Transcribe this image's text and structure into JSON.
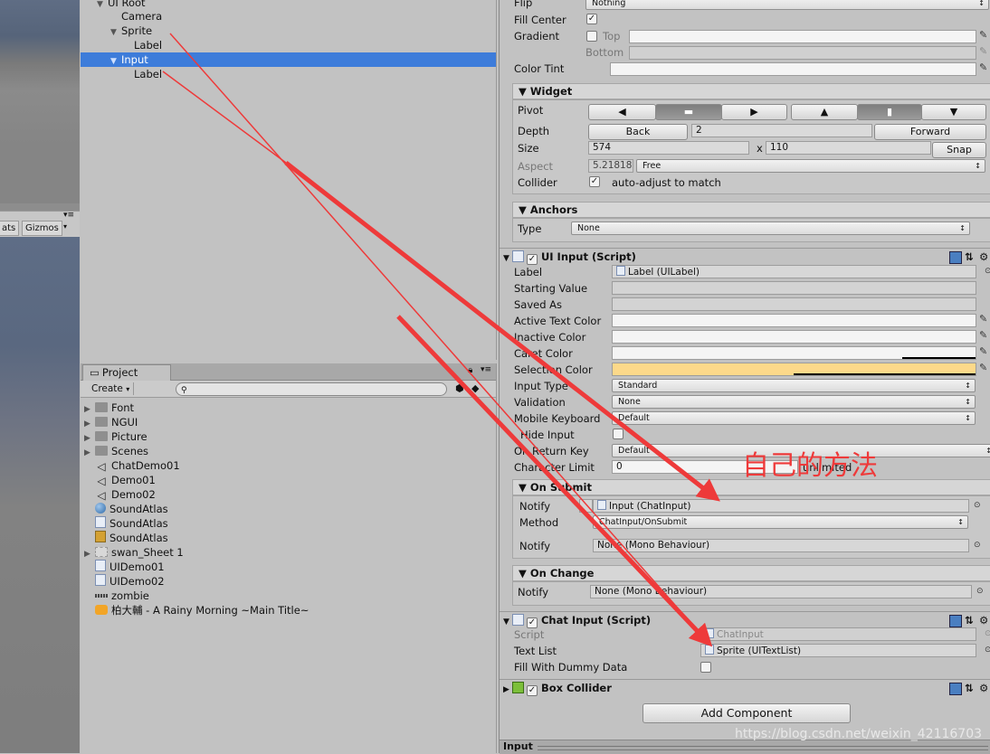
{
  "scene_toolbar": {
    "stats": "ats",
    "gizmos": "Gizmos"
  },
  "hierarchy": {
    "items": [
      {
        "label": "UI Root",
        "expanded": true
      },
      {
        "label": "Camera"
      },
      {
        "label": "Sprite",
        "expanded": true
      },
      {
        "label": "Label"
      },
      {
        "label": "Input",
        "expanded": true,
        "selected": true
      },
      {
        "label": "Label"
      }
    ]
  },
  "project": {
    "tab": "Project",
    "create": "Create",
    "items": [
      {
        "label": "Font",
        "icon": "folder-icon"
      },
      {
        "label": "NGUI",
        "icon": "folder-icon"
      },
      {
        "label": "Picture",
        "icon": "folder-icon"
      },
      {
        "label": "Scenes",
        "icon": "folder-icon"
      },
      {
        "label": "ChatDemo01",
        "icon": "unity-scene-icon"
      },
      {
        "label": "Demo01",
        "icon": "unity-scene-icon"
      },
      {
        "label": "Demo02",
        "icon": "unity-scene-icon"
      },
      {
        "label": "SoundAtlas",
        "icon": "sphere-icon"
      },
      {
        "label": "SoundAtlas",
        "icon": "script-icon"
      },
      {
        "label": "SoundAtlas",
        "icon": "atlas-icon"
      },
      {
        "label": "swan_Sheet 1",
        "icon": "sprite-sheet-icon"
      },
      {
        "label": "UIDemo01",
        "icon": "script-icon"
      },
      {
        "label": "UIDemo02",
        "icon": "script-icon"
      },
      {
        "label": "zombie",
        "icon": "texture-icon"
      },
      {
        "label": "柏大輔 - A Rainy Morning ~Main Title~",
        "icon": "audio-icon"
      }
    ]
  },
  "inspector": {
    "flip": {
      "label": "Flip",
      "value": "Nothing"
    },
    "fill_center": {
      "label": "Fill Center",
      "checked": true
    },
    "gradient": {
      "label": "Gradient",
      "top": "Top",
      "bottom": "Bottom"
    },
    "color_tint": {
      "label": "Color Tint"
    },
    "widget": {
      "title": "Widget",
      "pivot": "Pivot",
      "depth": "Depth",
      "back": "Back",
      "depth_value": "2",
      "forward": "Forward",
      "size": "Size",
      "width": "574",
      "x": "x",
      "height": "110",
      "snap": "Snap",
      "aspect": "Aspect",
      "aspect_value": "5.21818",
      "aspect_mode": "Free",
      "collider": "Collider",
      "collider_text": "auto-adjust to match"
    },
    "anchors": {
      "title": "Anchors",
      "type": "Type",
      "type_value": "None"
    },
    "ui_input": {
      "title": "UI Input (Script)",
      "fields": {
        "label": "Label",
        "label_value": "Label (UILabel)",
        "starting_value": "Starting Value",
        "saved_as": "Saved As",
        "active_text_color": "Active Text Color",
        "inactive_color": "Inactive Color",
        "caret_color": "Caret Color",
        "selection_color": "Selection Color",
        "input_type": "Input Type",
        "input_type_value": "Standard",
        "validation": "Validation",
        "validation_value": "None",
        "mobile_keyboard": "Mobile Keyboard",
        "mobile_keyboard_value": "Default",
        "hide_input": "Hide Input",
        "on_return_key": "On Return Key",
        "on_return_key_value": "Default",
        "character_limit": "Character Limit",
        "character_limit_value": "0",
        "unlimited": "unlimited"
      },
      "on_submit": {
        "title": "On Submit",
        "notify": "Notify",
        "notify_value": "Input (ChatInput)",
        "method": "Method",
        "method_value": "ChatInput/OnSubmit",
        "notify2": "Notify",
        "notify2_value": "None (Mono Behaviour)"
      },
      "on_change": {
        "title": "On Change",
        "notify": "Notify",
        "notify_value": "None (Mono Behaviour)"
      }
    },
    "chat_input": {
      "title": "Chat Input (Script)",
      "script": "Script",
      "script_value": "ChatInput",
      "text_list": "Text List",
      "text_list_value": "Sprite (UITextList)",
      "fill_dummy": "Fill With Dummy Data"
    },
    "box_collider": {
      "title": "Box Collider"
    },
    "add_component": "Add Component",
    "bottom_label": "Input"
  },
  "annotation": "自己的方法",
  "watermark": "https://blog.csdn.net/weixin_42116703",
  "colors": {
    "selection": "#3d7cda",
    "selection_color_swatch": "#fcd98a",
    "arrow": "#ee3a3a"
  }
}
